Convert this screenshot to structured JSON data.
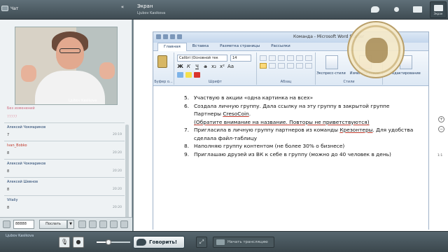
{
  "header": {
    "chat_tab_label": "Чат",
    "collapse_glyph": "«",
    "screen_title": "Экран",
    "presenter_name": "Ljubov Kasikova",
    "right_buttons": [
      {
        "label": "",
        "icon": "chat-bubble-icon"
      },
      {
        "label": "",
        "icon": "person-icon"
      },
      {
        "label": "",
        "icon": "monitor-icon"
      },
      {
        "label": "Экран",
        "icon": "screen-icon"
      }
    ]
  },
  "chat": {
    "video_caption": "Ljubov Kasikova",
    "status_label": "Без изменений",
    "status_sub": "77777",
    "messages": [
      {
        "name": "Алексей Чокмариков",
        "text": "7",
        "time": "20:19",
        "red": false
      },
      {
        "name": "Ivan_Bobko",
        "text": "8",
        "time": "20:20",
        "red": true
      },
      {
        "name": "Алексей Чокмариков",
        "text": "8",
        "time": "20:20",
        "red": false
      },
      {
        "name": "Алексей Шевнов",
        "text": "8",
        "time": "20:20",
        "red": false
      },
      {
        "name": "Vitaliy",
        "text": "8",
        "time": "20:20",
        "red": false
      }
    ],
    "input_value": "88888",
    "send_label": "Послать",
    "send_dropdown": "▼"
  },
  "word": {
    "window_title": "Команда - Microsoft Word Starter",
    "tabs": [
      "Главная",
      "Вставка",
      "Разметка страницы",
      "Рассылки"
    ],
    "font_name": "Calibri (Основной тек",
    "font_size": "14",
    "groups": {
      "font": "Шрифт",
      "paragraph": "Абзац",
      "styles": "Стили",
      "clipboard": "Буфер о..."
    },
    "express_styles": "Экспресс-стили",
    "change_styles": "Изменить стили",
    "editing": "Редактирование",
    "items": [
      {
        "n": "5.",
        "text": "Участвую  в акции «одна картинка на всех»"
      },
      {
        "n": "6.",
        "text": "Создала личную  группу.  Дала  ссылку на эту группу  в закрытой группе Партнеры ",
        "u": "CresoCoin",
        "tail": "."
      },
      {
        "n": "",
        "text": "(Обратите внимание на название. Повторы не приветствуются)"
      },
      {
        "n": "7.",
        "text": "Пригласила в личную группу партнеров из команды ",
        "u": "Крезонтеры",
        "tail": ". Для удобства сделала файл-таблицу"
      },
      {
        "n": "8.",
        "text": "Наполняю группу контентом (не более 30% о бизнесе)"
      },
      {
        "n": "9.",
        "text": "Приглашаю друзей из ВК к себе в группу (можно до 40 человек в день)"
      }
    ]
  },
  "zoom": {
    "plus": "+",
    "minus": "−",
    "level": "1:1"
  },
  "footer": {
    "user_name": "Ljubov Kasikova",
    "talk_label": "Говорить!",
    "broadcast_label": "Начать трансляцию",
    "fullscreen_glyph": "⤢",
    "volume_fraction": 0.35
  }
}
